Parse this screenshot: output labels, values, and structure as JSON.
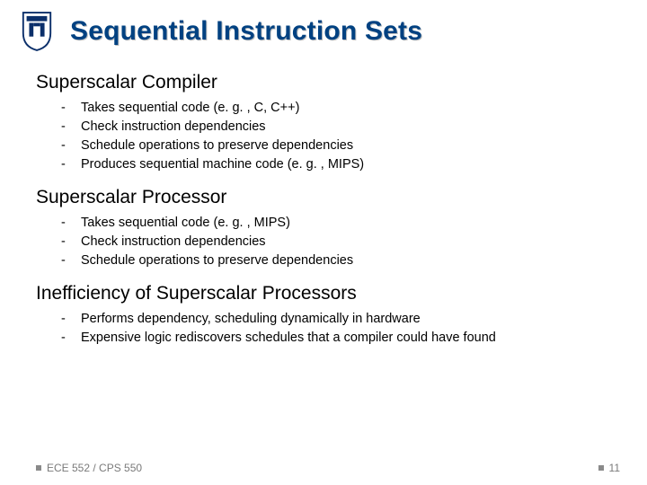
{
  "title": "Sequential Instruction Sets",
  "sections": [
    {
      "heading": "Superscalar Compiler",
      "items": [
        "Takes sequential code (e. g. , C, C++)",
        "Check instruction dependencies",
        "Schedule operations to preserve dependencies",
        "Produces sequential machine code (e. g. , MIPS)"
      ]
    },
    {
      "heading": "Superscalar Processor",
      "items": [
        "Takes sequential code (e. g. , MIPS)",
        "Check instruction dependencies",
        "Schedule operations to preserve dependencies"
      ]
    },
    {
      "heading": "Inefficiency of Superscalar Processors",
      "items": [
        "Performs dependency, scheduling dynamically in hardware",
        "Expensive logic rediscovers schedules that a compiler could have found"
      ]
    }
  ],
  "footer": {
    "left": "ECE 552 / CPS 550",
    "right": "11"
  }
}
